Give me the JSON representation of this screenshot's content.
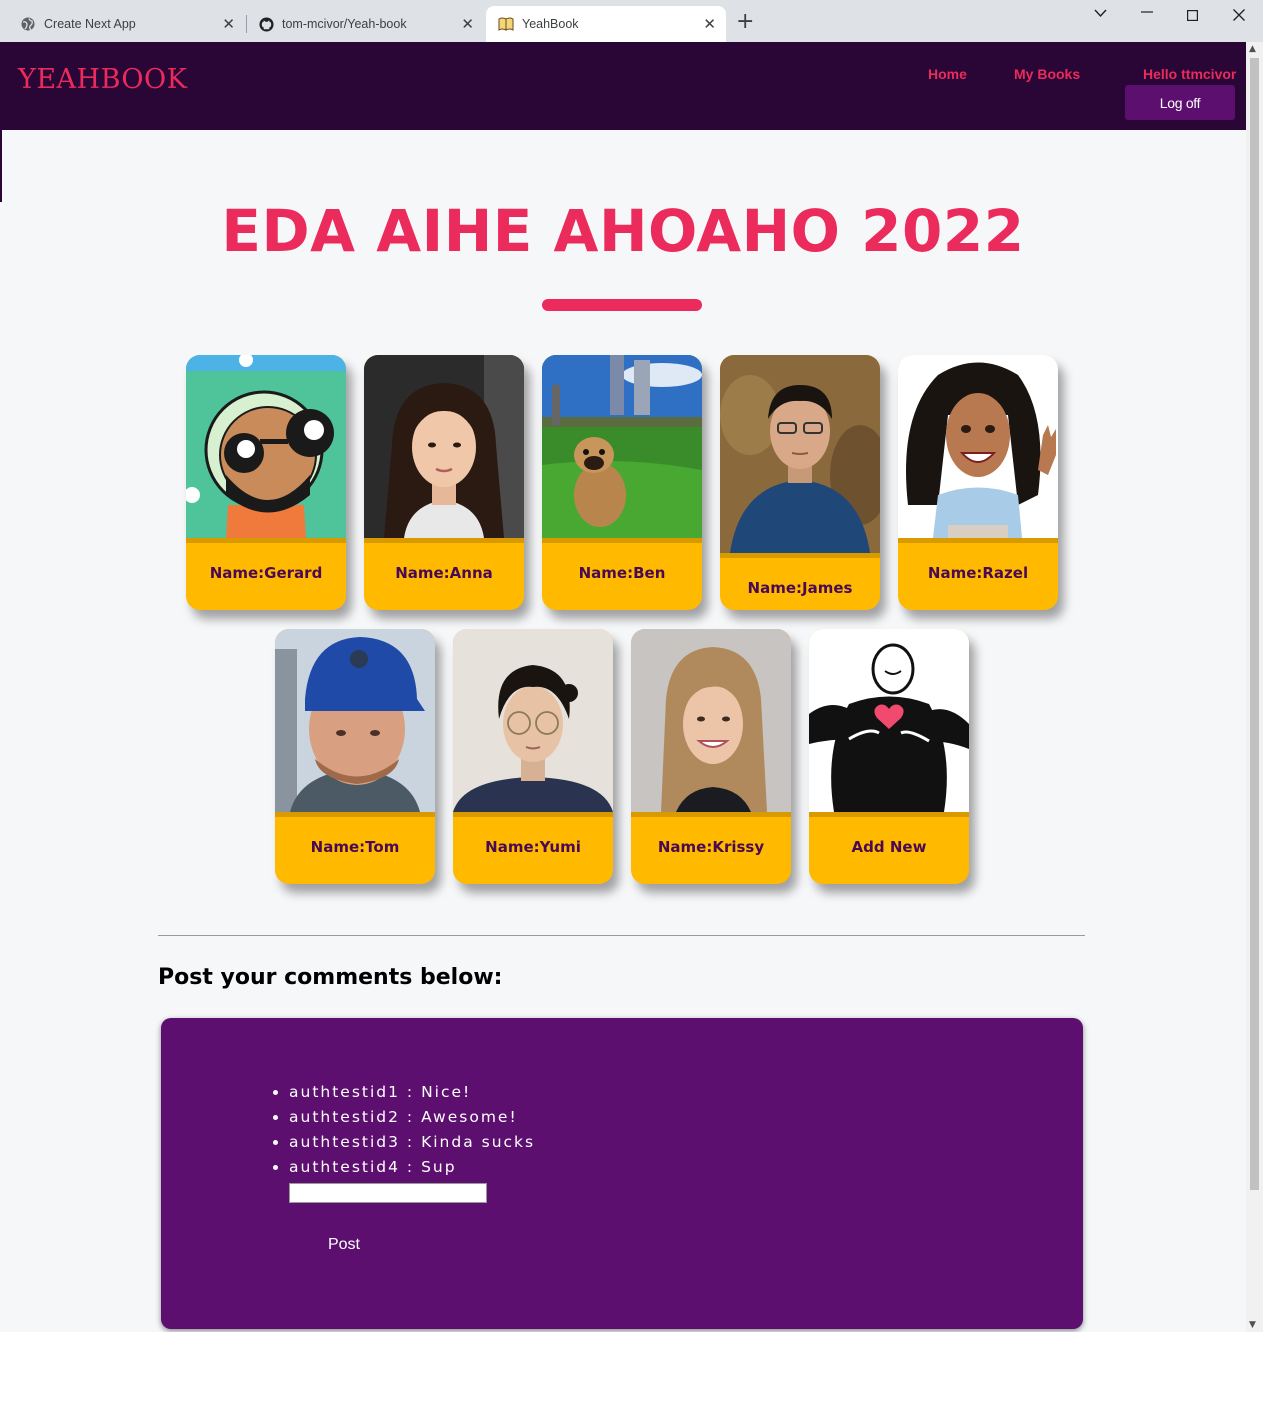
{
  "browser": {
    "tabs": [
      {
        "title": "Create Next App",
        "icon": "globe-icon"
      },
      {
        "title": "tom-mcivor/Yeah-book",
        "icon": "github-icon"
      },
      {
        "title": "YeahBook",
        "icon": "book-icon",
        "active": true
      }
    ],
    "new_tab": "+",
    "close_glyph": "✕"
  },
  "nav": {
    "logo": "YEAHBOOK",
    "links": [
      "Home",
      "My Books"
    ],
    "greeting": "Hello ttmcivor",
    "logoff": "Log off"
  },
  "page": {
    "title": "EDA AIHE AHOAHO 2022",
    "cards": [
      {
        "name": "Name:Gerard"
      },
      {
        "name": "Name:Anna"
      },
      {
        "name": "Name:Ben"
      },
      {
        "name": "Name:James"
      },
      {
        "name": "Name:Razel"
      },
      {
        "name": "Name:Tom"
      },
      {
        "name": "Name:Yumi"
      },
      {
        "name": "Name:Krissy"
      },
      {
        "name": "Add New"
      }
    ]
  },
  "comments": {
    "heading": "Post your comments below:",
    "items": [
      "authtestid1 : Nice!",
      "authtestid2 : Awesome!",
      "authtestid3 : Kinda sucks",
      "authtestid4 : Sup"
    ],
    "input_value": "",
    "post_label": "Post"
  },
  "colors": {
    "nav_bg": "#290636",
    "accent": "#ea2b5c",
    "card_bg": "#ffba00",
    "comments_bg": "#5c0f6e"
  }
}
